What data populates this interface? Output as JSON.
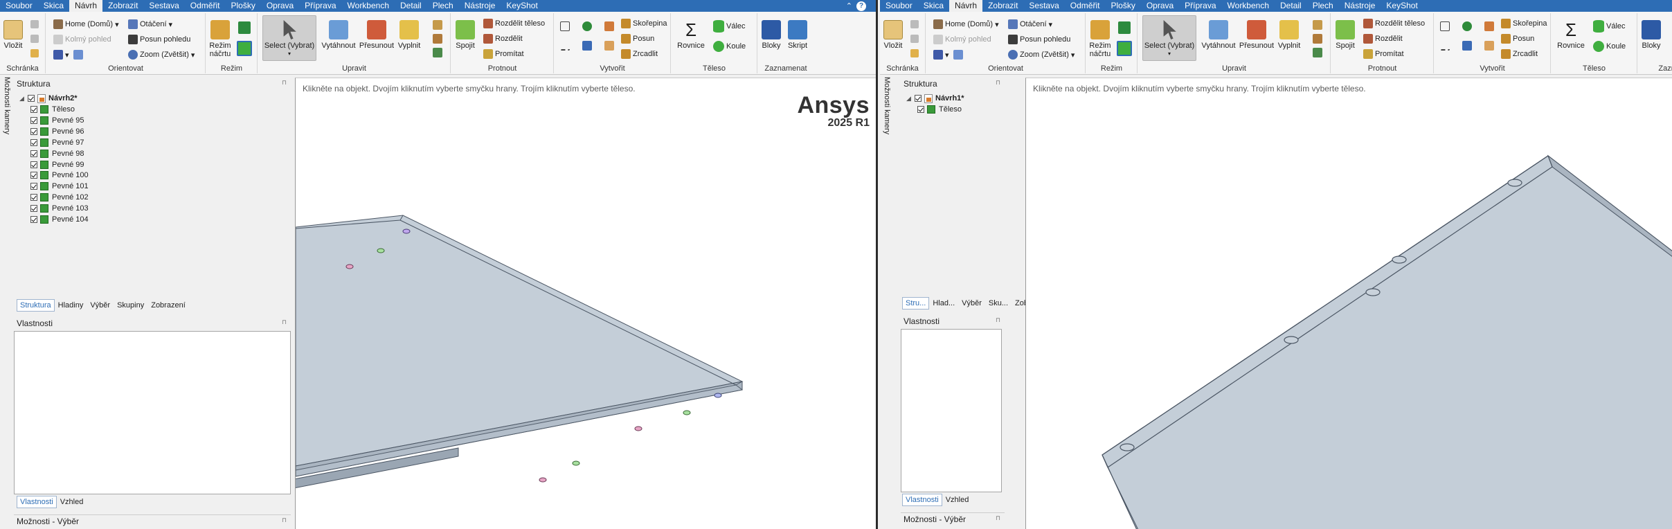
{
  "left": {
    "menu": [
      "Soubor",
      "Skica",
      "Návrh",
      "Zobrazit",
      "Sestava",
      "Odměřit",
      "Plošky",
      "Oprava",
      "Příprava",
      "Workbench",
      "Detail",
      "Plech",
      "Nástroje",
      "KeyShot"
    ],
    "menu_active": "Návrh",
    "ribbon": {
      "clipboard": {
        "paste": "Vložit",
        "label": "Schránka"
      },
      "orient": {
        "home": "Home (Domů)",
        "perpendicular": "Kolmý pohled",
        "rotate": "Otáčení",
        "pan": "Posun pohledu",
        "zoom": "Zoom (Zvětšit)",
        "label": "Orientovat"
      },
      "mode": {
        "sketch": "Režim\nnáčrtu",
        "label": "Režim"
      },
      "edit": {
        "select": "Select (Vybrat)",
        "pull": "Vytáhnout",
        "move": "Přesunout",
        "fill": "Vyplnit",
        "label": "Upravit"
      },
      "intersect": {
        "combine": "Spojit",
        "split_body": "Rozdělit těleso",
        "split": "Rozdělit",
        "project": "Promítat",
        "label": "Protnout"
      },
      "create": {
        "shell": "Skořepina",
        "offset": "Posun",
        "mirror": "Zrcadlit",
        "label": "Vytvořit"
      },
      "body": {
        "equation": "Rovnice",
        "cylinder": "Válec",
        "sphere": "Koule",
        "label": "Těleso"
      },
      "record": {
        "blocks": "Bloky",
        "script": "Skript",
        "label": "Zaznamenat"
      }
    },
    "side_tab": "Možnosti kamery",
    "structure": {
      "title": "Struktura",
      "root": "Návrh2*",
      "items": [
        "Těleso",
        "Pevné 95",
        "Pevné 96",
        "Pevné 97",
        "Pevné 98",
        "Pevné 99",
        "Pevné 100",
        "Pevné 101",
        "Pevné 102",
        "Pevné 103",
        "Pevné 104"
      ],
      "tabs": [
        "Struktura",
        "Hladiny",
        "Výběr",
        "Skupiny",
        "Zobrazení"
      ]
    },
    "properties": {
      "title": "Vlastnosti",
      "tabs": [
        "Vlastnosti",
        "Vzhled"
      ]
    },
    "options_title": "Možnosti - Výběr",
    "viewport": {
      "hint": "Klikněte na objekt. Dvojím kliknutím vyberte smyčku hrany. Trojím kliknutím vyberte těleso.",
      "brand": "Ansys",
      "version": "2025 R1"
    }
  },
  "right": {
    "menu": [
      "Soubor",
      "Skica",
      "Návrh",
      "Zobrazit",
      "Sestava",
      "Odměřit",
      "Plošky",
      "Oprava",
      "Příprava",
      "Workbench",
      "Detail",
      "Plech",
      "Nástroje",
      "KeyShot"
    ],
    "menu_active": "Návrh",
    "ribbon": {
      "clipboard": {
        "paste": "Vložit",
        "label": "Schránka"
      },
      "orient": {
        "home": "Home (Domů)",
        "perpendicular": "Kolmý pohled",
        "rotate": "Otáčení",
        "pan": "Posun pohledu",
        "zoom": "Zoom (Zvětšit)",
        "label": "Orientovat"
      },
      "mode": {
        "sketch": "Režim\nnáčrtu",
        "label": "Režim"
      },
      "edit": {
        "select": "Select (Vybrat)",
        "pull": "Vytáhnout",
        "move": "Přesunout",
        "fill": "Vyplnit",
        "label": "Upravit"
      },
      "intersect": {
        "combine": "Spojit",
        "split_body": "Rozdělit těleso",
        "split": "Rozdělit",
        "project": "Promítat",
        "label": "Protnout"
      },
      "create": {
        "shell": "Skořepina",
        "offset": "Posun",
        "mirror": "Zrcadlit",
        "label": "Vytvořit"
      },
      "body": {
        "equation": "Rovnice",
        "cylinder": "Válec",
        "sphere": "Koule",
        "label": "Těleso"
      },
      "record": {
        "blocks": "Bloky",
        "label_partial": "Zazna"
      }
    },
    "side_tab": "Možnosti kamery",
    "structure": {
      "title": "Struktura",
      "root": "Návrh1*",
      "items": [
        "Těleso"
      ],
      "tabs": [
        "Stru...",
        "Hlad...",
        "Výběr",
        "Sku...",
        "Zobr..."
      ]
    },
    "properties": {
      "title": "Vlastnosti",
      "tabs": [
        "Vlastnosti",
        "Vzhled"
      ]
    },
    "options_title": "Možnosti - Výběr",
    "viewport": {
      "hint": "Klikněte na objekt. Dvojím kliknutím vyberte smyčku hrany. Trojím kliknutím vyberte těleso."
    }
  },
  "colors": {
    "menu_bg": "#2d6db5",
    "plate_top": "#c4ced8",
    "plate_side": "#aab5c1",
    "plate_edge": "#4a5563",
    "body_icon": "#3a9a3a"
  }
}
